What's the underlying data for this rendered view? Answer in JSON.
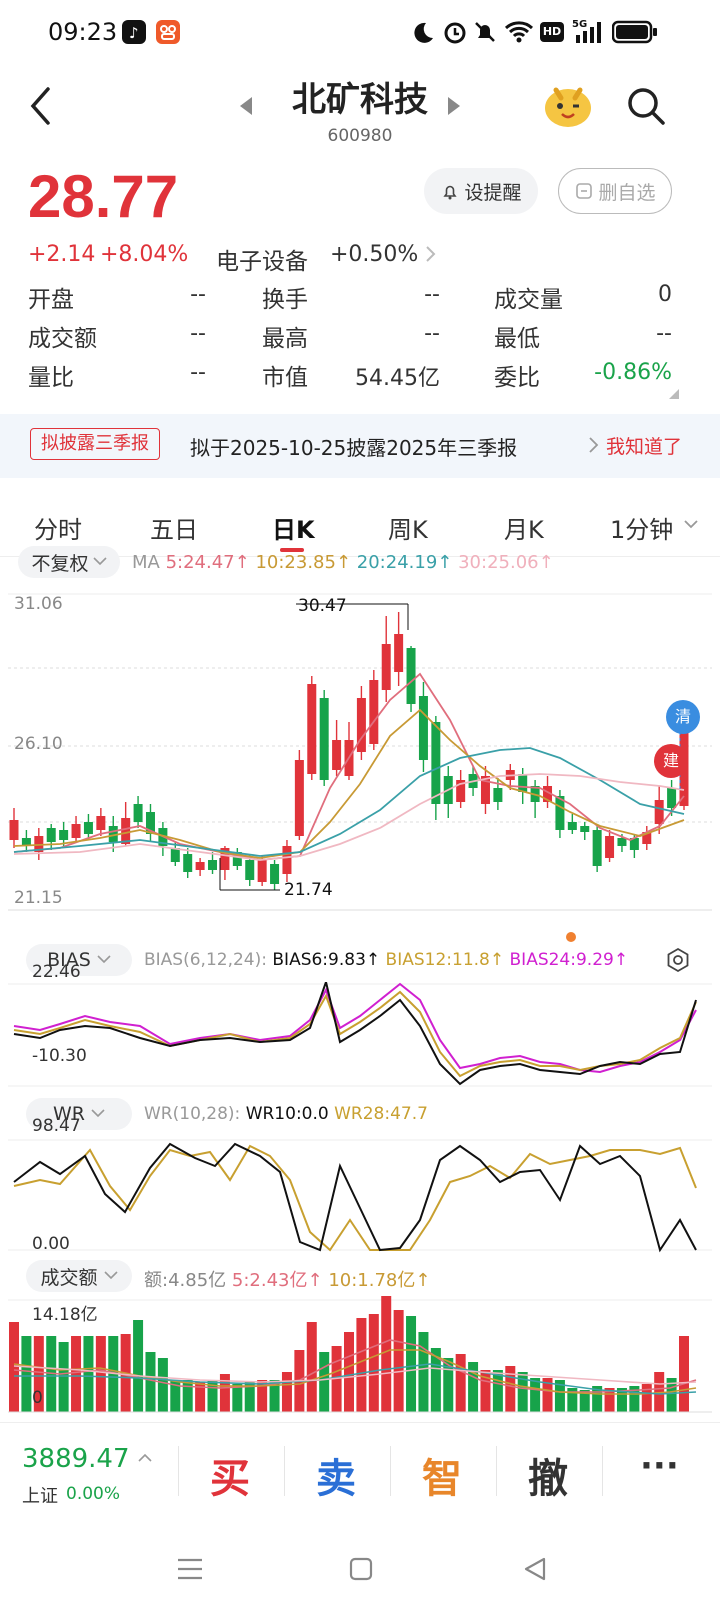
{
  "status": {
    "time": "09:23",
    "network": "5G"
  },
  "header": {
    "name": "北矿科技",
    "code": "600980"
  },
  "quote": {
    "price": "28.77",
    "change": "+2.14",
    "change_pct": "+8.04%",
    "sector_name": "电子设备",
    "sector_pct": "+0.50%",
    "alert_label": "设提醒",
    "remove_label": "删自选",
    "grid": [
      [
        {
          "l": "开盘",
          "v": "--"
        },
        {
          "l": "换手",
          "v": "--"
        },
        {
          "l": "成交量",
          "v": "0"
        }
      ],
      [
        {
          "l": "成交额",
          "v": "--"
        },
        {
          "l": "最高",
          "v": "--"
        },
        {
          "l": "最低",
          "v": "--"
        }
      ],
      [
        {
          "l": "量比",
          "v": "--"
        },
        {
          "l": "市值",
          "v": "54.45亿"
        },
        {
          "l": "委比",
          "v": "-0.86%"
        }
      ]
    ]
  },
  "banner": {
    "tag": "拟披露三季报",
    "text": "拟于2025-10-25披露2025年三季报",
    "action": "我知道了"
  },
  "tabs": [
    "分时",
    "五日",
    "日K",
    "周K",
    "月K",
    "1分钟"
  ],
  "active_tab": "日K",
  "kchart": {
    "adjust": "不复权",
    "ma_prefix": "MA",
    "ma5": "5:24.47",
    "ma10": "10:23.85",
    "ma20": "20:24.19",
    "ma30": "30:25.06",
    "y_top": "31.06",
    "y_mid": "26.10",
    "y_bot": "21.15",
    "high_label": "30.47",
    "low_label": "21.74",
    "mark_clear": "清",
    "mark_build": "建",
    "colors": {
      "up": "#e0333a",
      "down": "#17a34a",
      "ma5": "#e06e7d",
      "ma10": "#c89a35",
      "ma20": "#3aa0a8",
      "ma30": "#f0b8c2"
    }
  },
  "bias": {
    "name": "BIAS",
    "params": "BIAS(6,12,24):",
    "b6": "BIAS6:9.83",
    "b12": "BIAS12:11.8",
    "b24": "BIAS24:9.29",
    "y_top": "22.46",
    "y_bot": "-10.30"
  },
  "wr": {
    "name": "WR",
    "params": "WR(10,28):",
    "wr10": "WR10:0.0",
    "wr28": "WR28:47.7",
    "y_top": "98.47",
    "y_bot": "0.00"
  },
  "amount": {
    "name": "成交额",
    "label": "额:4.85亿",
    "ma5": "5:2.43亿",
    "ma10": "10:1.78亿",
    "y_top": "14.18亿",
    "y_bot": "0"
  },
  "bottom": {
    "index_value": "3889.47",
    "index_name": "上证",
    "index_pct": "0.00%",
    "buy": "买",
    "sell": "卖",
    "smart": "智",
    "cancel": "撤",
    "more": "···"
  }
}
